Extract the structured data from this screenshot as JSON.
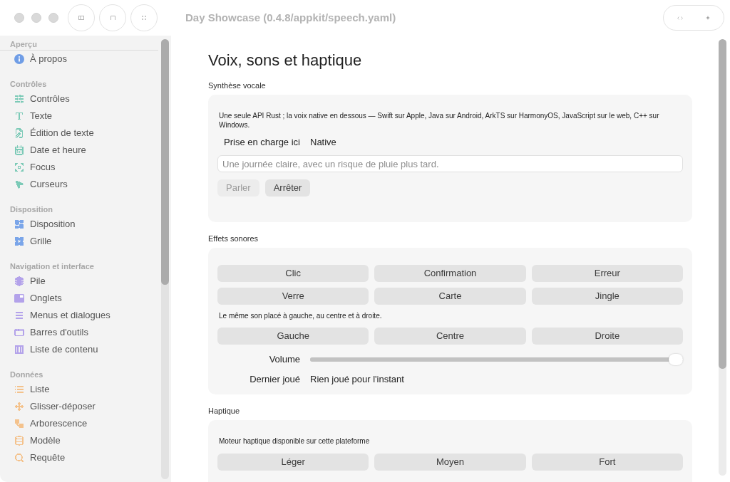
{
  "window": {
    "title": "Day Showcase (0.4.8/appkit/speech.yaml)"
  },
  "sidebar": {
    "sections": [
      {
        "title": "Aperçu",
        "color": "#6f9de6",
        "items": [
          {
            "label": "À propos",
            "selected": false
          }
        ]
      },
      {
        "title": "Contrôles",
        "color": "#7ccab7",
        "items": [
          {
            "label": "Contrôles",
            "selected": false
          },
          {
            "label": "Texte",
            "selected": false
          },
          {
            "label": "Édition de texte",
            "selected": false
          },
          {
            "label": "Date et heure",
            "selected": false
          },
          {
            "label": "Focus",
            "selected": false
          },
          {
            "label": "Curseurs",
            "selected": false
          }
        ]
      },
      {
        "title": "Disposition",
        "color": "#7aa5e9",
        "items": [
          {
            "label": "Disposition",
            "selected": false
          },
          {
            "label": "Grille",
            "selected": false
          }
        ]
      },
      {
        "title": "Navigation et interface",
        "color": "#b3a2ea",
        "items": [
          {
            "label": "Pile",
            "selected": false
          },
          {
            "label": "Onglets",
            "selected": false
          },
          {
            "label": "Menus et dialogues",
            "selected": false
          },
          {
            "label": "Barres d'outils",
            "selected": false
          },
          {
            "label": "Liste de contenu",
            "selected": false
          }
        ]
      },
      {
        "title": "Données",
        "color": "#f4c28c",
        "items": [
          {
            "label": "Liste",
            "selected": false
          },
          {
            "label": "Glisser-déposer",
            "selected": false
          },
          {
            "label": "Arborescence",
            "selected": false
          },
          {
            "label": "Modèle",
            "selected": false
          },
          {
            "label": "Requête",
            "selected": false
          }
        ]
      }
    ]
  },
  "page": {
    "title": "Voix, sons et haptique",
    "sections": [
      {
        "kind": "speech",
        "title": "Synthèse vocale",
        "description": "Une seule API Rust ; la voix native en dessous — Swift sur Apple, Java sur Android, ArkTS sur HarmonyOS, JavaScript sur le web, C++ sur Windows.",
        "support": {
          "label": "Prise en charge ici",
          "value": "Native"
        },
        "input": {
          "placeholder": "Une journée claire, avec un risque de pluie plus tard."
        },
        "buttons": [
          {
            "label": "Parler",
            "disabled": true
          },
          {
            "label": "Arrêter",
            "disabled": false
          }
        ]
      },
      {
        "kind": "sounds",
        "title": "Effets sonores",
        "buttons": [
          {
            "label": "Clic"
          },
          {
            "label": "Confirmation"
          },
          {
            "label": "Erreur"
          },
          {
            "label": "Verre"
          },
          {
            "label": "Carte"
          },
          {
            "label": "Jingle"
          }
        ],
        "pan_caption": "Le même son placé à gauche, au centre et à droite.",
        "pan_buttons": [
          {
            "label": "Gauche"
          },
          {
            "label": "Centre"
          },
          {
            "label": "Droite"
          }
        ],
        "volume": {
          "label": "Volume",
          "level": 1
        },
        "last_played": {
          "label": "Dernier joué",
          "value": "Rien joué pour l'instant"
        }
      },
      {
        "kind": "haptics",
        "title": "Haptique",
        "caption": "Moteur haptique disponible sur cette plateforme",
        "buttons": [
          {
            "label": "Léger"
          },
          {
            "label": "Moyen"
          },
          {
            "label": "Fort"
          }
        ]
      }
    ]
  }
}
